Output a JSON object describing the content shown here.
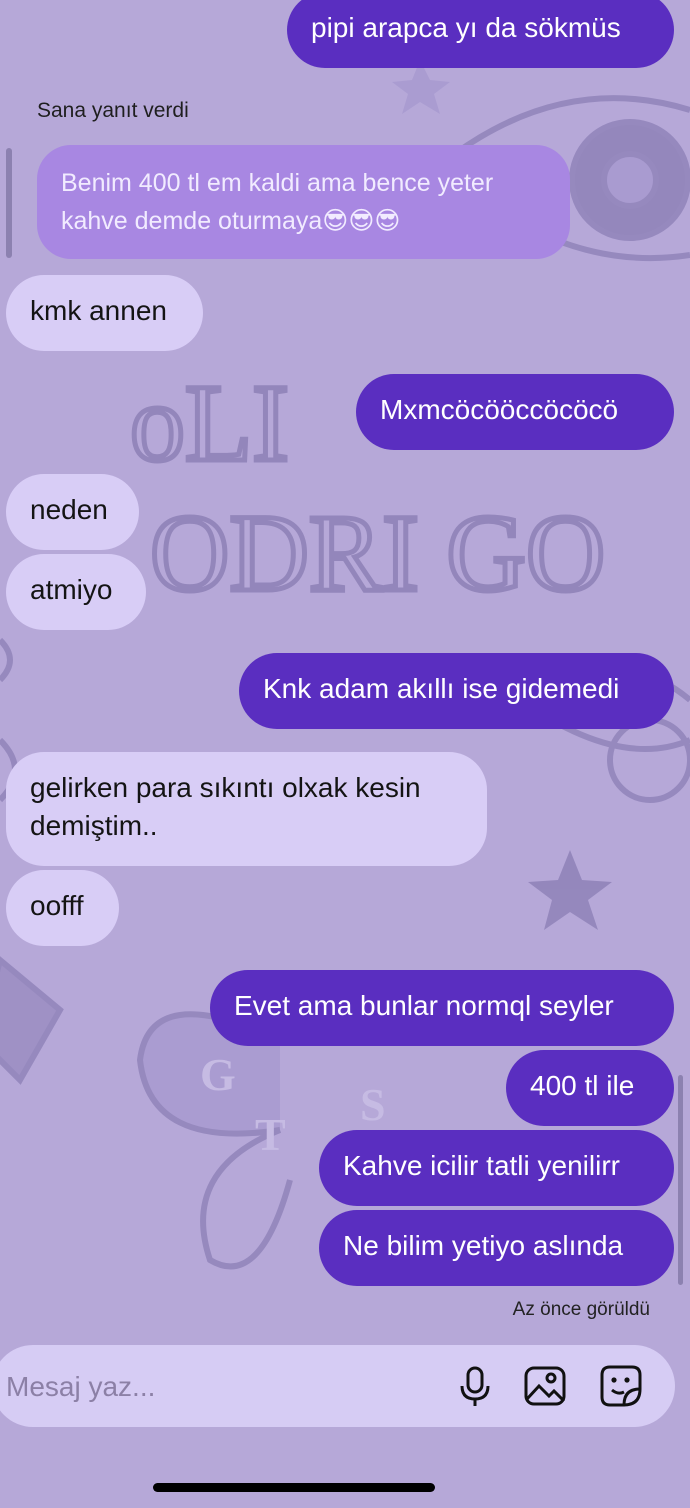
{
  "reply_label": "Sana yanıt verdi",
  "replied_message": "Benim 400 tl em kaldi ama bence yeter kahve demde oturmaya😎😎😎",
  "messages": [
    {
      "text": "pipi arapca yı da sökmüs",
      "direction": "outgoing"
    },
    {
      "text": "kmk annen",
      "direction": "incoming"
    },
    {
      "text": "Mxmcöcööccöcöcö",
      "direction": "outgoing"
    },
    {
      "text": "neden",
      "direction": "incoming"
    },
    {
      "text": "atmiyo",
      "direction": "incoming"
    },
    {
      "text": "Knk adam akıllı ise gidemedi",
      "direction": "outgoing"
    },
    {
      "text": "gelirken para sıkıntı olxak kesin demiştim..",
      "direction": "incoming"
    },
    {
      "text": "oofff",
      "direction": "incoming"
    },
    {
      "text": "Evet ama bunlar normql seyler",
      "direction": "outgoing"
    },
    {
      "text": "400 tl ile",
      "direction": "outgoing"
    },
    {
      "text": "Kahve icilir tatli yenilirr",
      "direction": "outgoing"
    },
    {
      "text": "Ne bilim yetiyo aslında",
      "direction": "outgoing"
    }
  ],
  "seen_status": "Az önce görüldü",
  "composer": {
    "placeholder": "Mesaj yaz...",
    "icons": [
      "microphone-icon",
      "image-icon",
      "sticker-icon"
    ]
  },
  "colors": {
    "background": "#b6a8d8",
    "outgoing_bubble": "#5a2ec0",
    "incoming_bubble": "#d8cdf6",
    "replied_bubble": "#a887e2"
  }
}
